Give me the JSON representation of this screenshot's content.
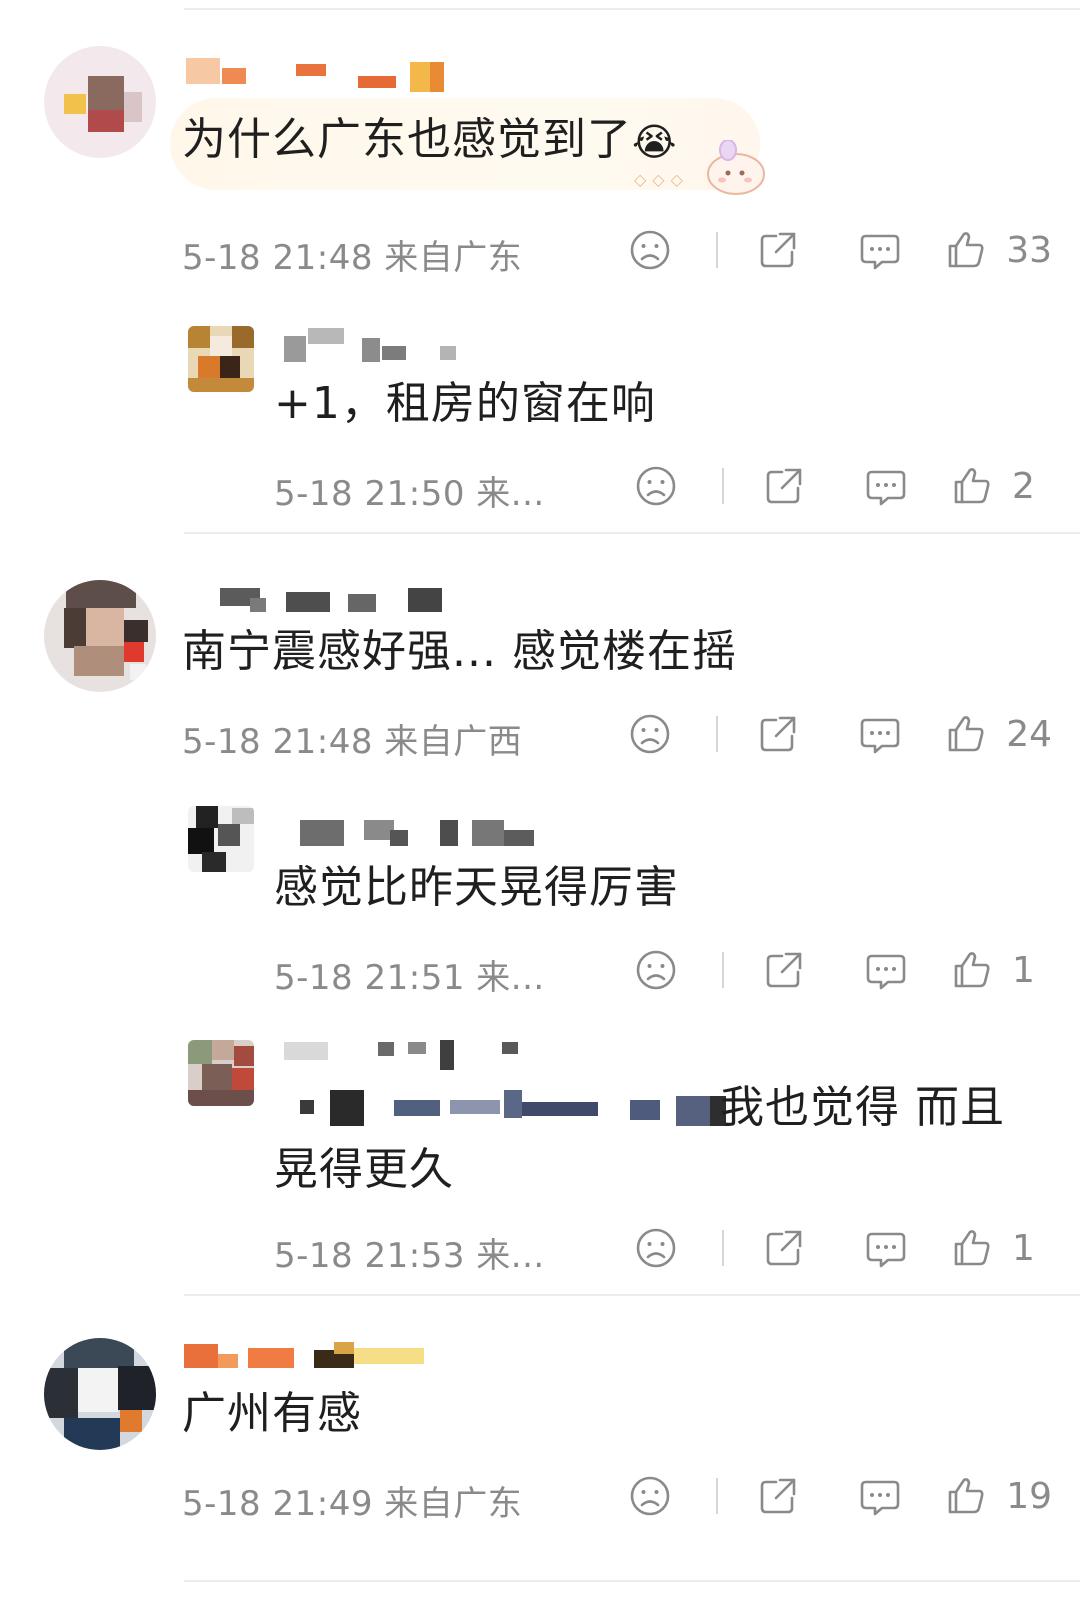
{
  "comments": [
    {
      "text": "为什么广东也感觉到了",
      "emoji": "😭",
      "time": "5-18 21:48",
      "location": "来自广东",
      "likes": "33",
      "replies": [
        {
          "text": "+1，租房的窗在响",
          "time": "5-18 21:50",
          "location": "来...",
          "likes": "2"
        }
      ]
    },
    {
      "text": "南宁震感好强... 感觉楼在摇",
      "time": "5-18 21:48",
      "location": "来自广西",
      "likes": "24",
      "replies": [
        {
          "text": "感觉比昨天晃得厉害",
          "time": "5-18 21:51",
          "location": "来...",
          "likes": "1"
        },
        {
          "text_line1": "我也觉得 而且",
          "text_line2": "晃得更久",
          "time": "5-18 21:53",
          "location": "来...",
          "likes": "1"
        }
      ]
    },
    {
      "text": "广州有感",
      "time": "5-18 21:49",
      "location": "来自广东",
      "likes": "19",
      "replies": []
    }
  ],
  "icons": {
    "dislike": "sad-face-icon",
    "share": "share-icon",
    "reply": "comment-icon",
    "like": "thumbs-up-icon"
  },
  "colors": {
    "text": "#1f1f1f",
    "meta": "#8a8a8a",
    "icon": "#8a8a8a",
    "divider": "#ececec"
  }
}
